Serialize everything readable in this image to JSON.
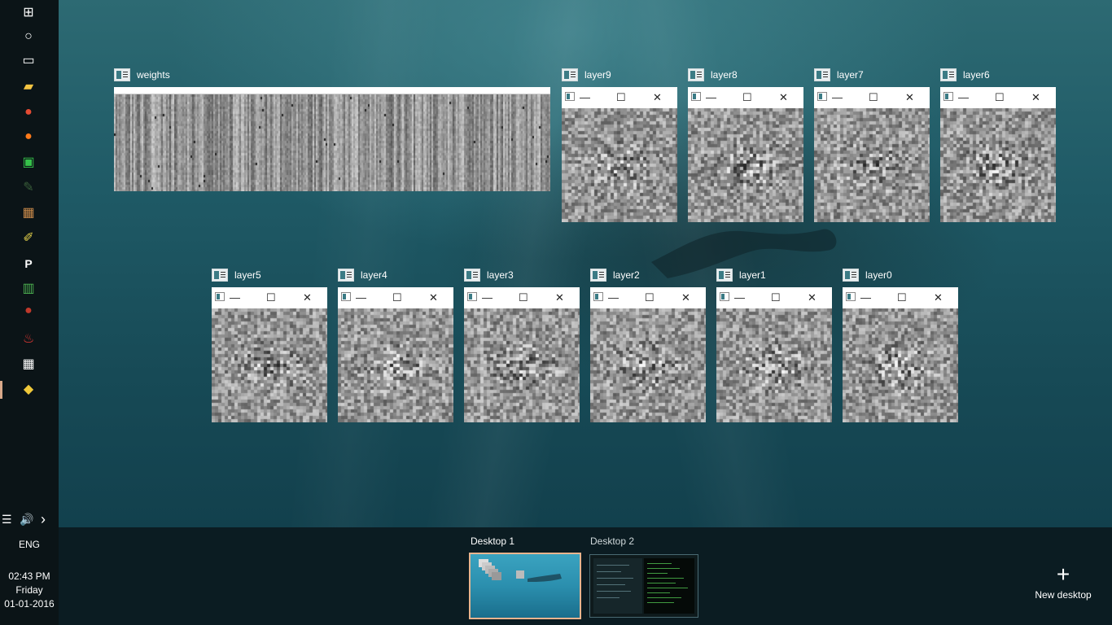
{
  "taskbar": {
    "pinned_icons": [
      {
        "name": "windows-start-icon",
        "glyph": "⊞",
        "color": "#ffffff"
      },
      {
        "name": "cortana-icon",
        "glyph": "○",
        "color": "#ffffff"
      },
      {
        "name": "task-view-icon",
        "glyph": "▭",
        "color": "#ffffff"
      },
      {
        "name": "file-explorer-icon",
        "glyph": "▰",
        "color": "#f5c542"
      },
      {
        "name": "chrome-icon",
        "glyph": "●",
        "color": "#e44b33"
      },
      {
        "name": "firefox-icon",
        "glyph": "●",
        "color": "#ff7a1a"
      },
      {
        "name": "network-app-icon",
        "glyph": "▣",
        "color": "#36c24a"
      },
      {
        "name": "inkscape-icon",
        "glyph": "✎",
        "color": "#3a5f3a"
      },
      {
        "name": "package-icon",
        "glyph": "▦",
        "color": "#c98a4a"
      },
      {
        "name": "python-idle-icon",
        "glyph": "✐",
        "color": "#e5d24b"
      },
      {
        "name": "p-app-icon",
        "glyph": "P",
        "color": "#ffffff"
      },
      {
        "name": "spreadsheet-app-icon",
        "glyph": "▥",
        "color": "#4caf50"
      },
      {
        "name": "red-app-icon",
        "glyph": "●",
        "color": "#c0392b"
      },
      {
        "name": "acrobat-icon",
        "glyph": "♨",
        "color": "#e53935"
      },
      {
        "name": "grid-app-icon",
        "glyph": "▦",
        "color": "#ffffff"
      },
      {
        "name": "python-icon",
        "glyph": "◆",
        "color": "#f0c93a"
      }
    ],
    "tray": {
      "action_center_glyph": "☰",
      "volume_glyph": "🔊",
      "chevron_glyph": "›"
    },
    "language": "ENG",
    "time": "02:43 PM",
    "day": "Friday",
    "date": "01-01-2016"
  },
  "windows": [
    {
      "title": "weights"
    },
    {
      "title": "layer9"
    },
    {
      "title": "layer8"
    },
    {
      "title": "layer7"
    },
    {
      "title": "layer6"
    },
    {
      "title": "layer5"
    },
    {
      "title": "layer4"
    },
    {
      "title": "layer3"
    },
    {
      "title": "layer2"
    },
    {
      "title": "layer1"
    },
    {
      "title": "layer0"
    }
  ],
  "window_controls": {
    "minimize": "—",
    "maximize": "☐",
    "close": "✕"
  },
  "desktops": [
    {
      "label": "Desktop 1"
    },
    {
      "label": "Desktop 2"
    }
  ],
  "new_desktop": {
    "label": "New desktop",
    "glyph": "+"
  },
  "colors": {
    "active_desktop_border": "#e8b48e",
    "taskbar_bg": "#0b1417",
    "switcher_bg": "#0b1c22"
  }
}
